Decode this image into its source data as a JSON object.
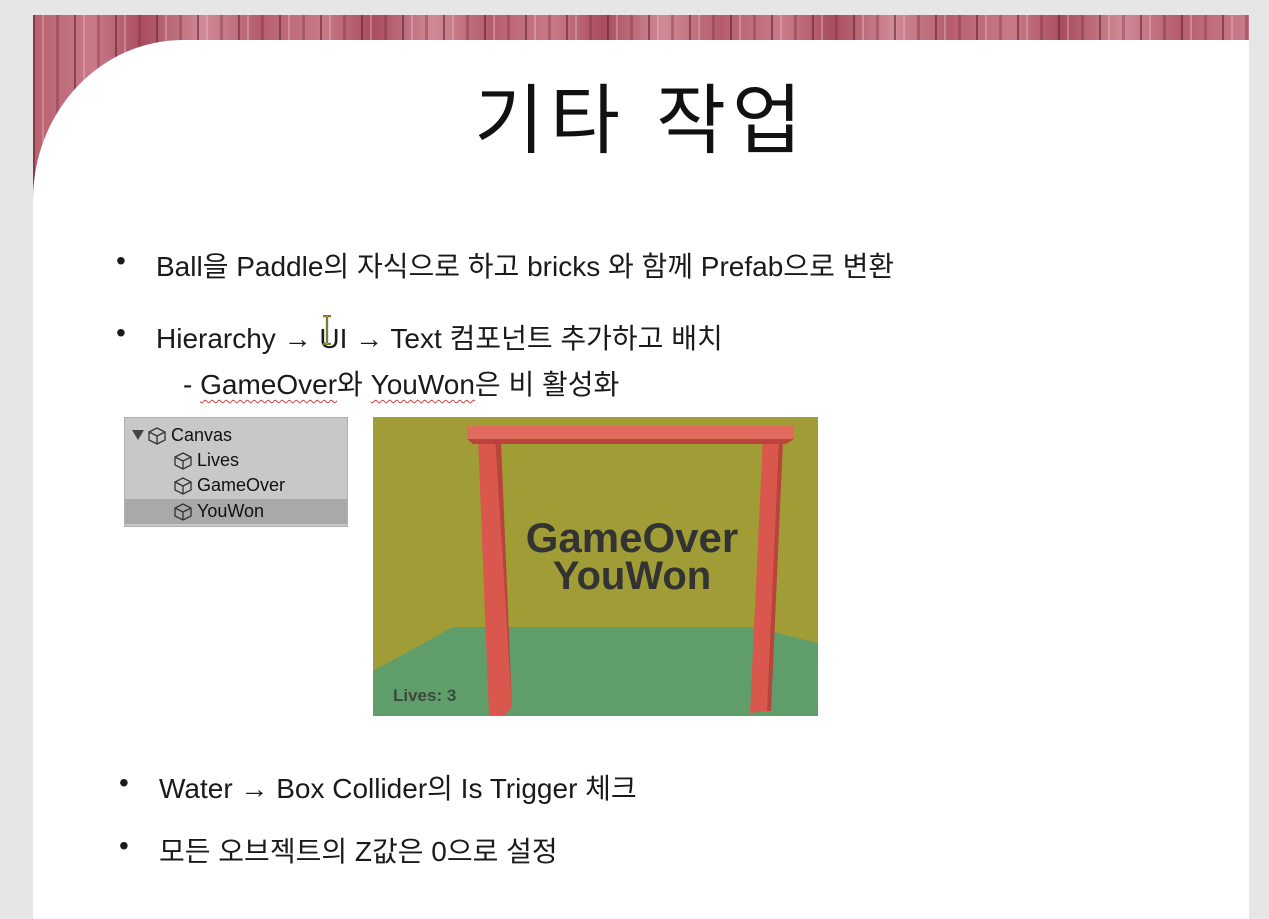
{
  "slide": {
    "title": "기타 작업",
    "bullets": [
      {
        "text": "Ball을 Paddle의 자식으로 하고 bricks 와 함께 Prefab으로 변환"
      },
      {
        "text": "Hierarchy → UI → Text 컴포넌트 추가하고 배치"
      },
      {
        "text": "Water → Box Collider의 Is Trigger 체크"
      },
      {
        "text": "모든 오브젝트의 Z값은 0으로 설정"
      }
    ],
    "sub_bullet": {
      "dash": "- ",
      "gameover": "GameOver",
      "wa": "와 ",
      "youwon": "YouWon",
      "rest": "은 비 활성화"
    }
  },
  "hierarchy": {
    "items": [
      {
        "label": "Canvas"
      },
      {
        "label": "Lives"
      },
      {
        "label": "GameOver"
      },
      {
        "label": "YouWon"
      }
    ]
  },
  "game_preview": {
    "gameover_text": "GameOver",
    "youwon_text": "YouWon",
    "lives_text": "Lives: 3",
    "colors": {
      "wall": "#a09d37",
      "floor": "#5f9e6b",
      "frame": "#d9574d",
      "text": "#333333"
    }
  },
  "colors": {
    "wood": "#b8606f",
    "slide_bg": "#ffffff",
    "text": "#1a1a1a",
    "spellcheck_underline": "#d04040"
  }
}
